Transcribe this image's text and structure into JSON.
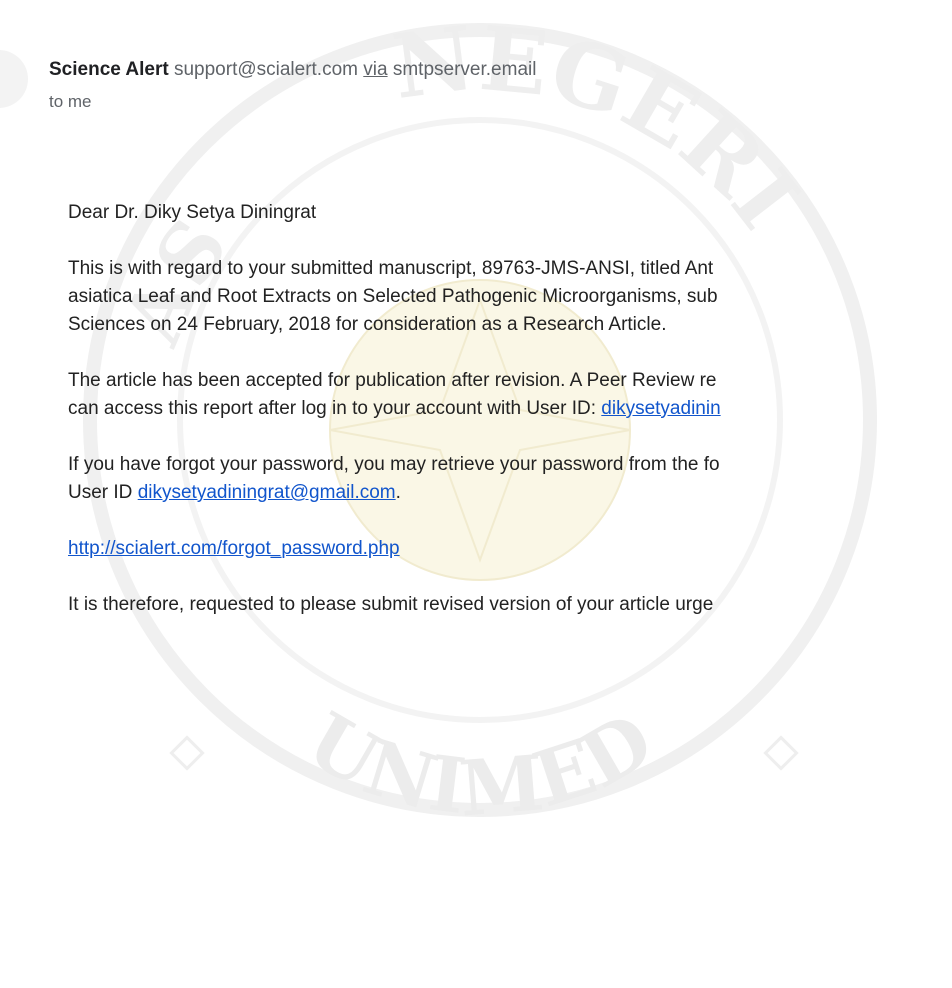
{
  "header": {
    "sender_name": "Science Alert",
    "sender_email": "support@scialert.com",
    "via_label": "via",
    "via_server": "smtpserver.email",
    "recipient": "to me"
  },
  "body": {
    "greeting": "Dear Dr. Diky Setya Diningrat",
    "para1_line1": "This is with regard to your submitted manuscript, 89763-JMS-ANSI, titled Ant",
    "para1_line2": "asiatica Leaf and Root Extracts on Selected Pathogenic Microorganisms, sub",
    "para1_line3": "Sciences on 24 February, 2018 for consideration as a Research Article.",
    "para2_line1": "The article has been accepted for publication after revision. A Peer Review re",
    "para2_line2_text": "can access this report after log in to your account with User ID: ",
    "para2_line2_link": "dikysetyadinin",
    "para3_line1": "If you have forgot your password, you may retrieve your password from the fo",
    "para3_line2_prefix": "User ID ",
    "para3_line2_link": "dikysetyadiningrat@gmail.com",
    "para3_line2_suffix": ".",
    "forgot_link": "http://scialert.com/forgot_password.php",
    "para5": "It is therefore, requested to please submit revised version of your article urge"
  },
  "watermark": {
    "top_text": "NEGERI",
    "top_left_text": "AS",
    "bottom_text": "UNIMED"
  },
  "colors": {
    "link": "#1155cc",
    "body_text": "#222222",
    "header_text": "#5f6368"
  }
}
